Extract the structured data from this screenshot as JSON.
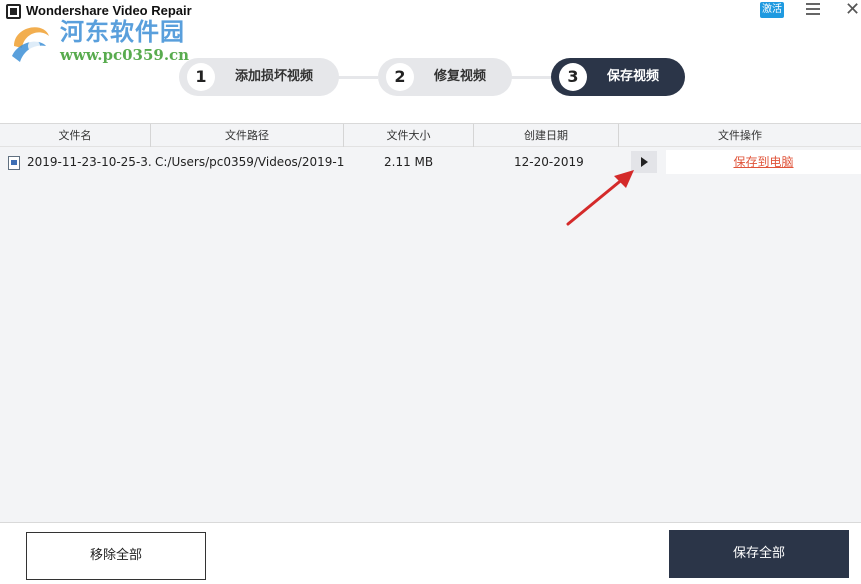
{
  "window": {
    "title": "Wondershare Video Repair",
    "activate_label": "激活",
    "menu_icon": "hamburger-menu-icon",
    "close_icon": "close-icon",
    "close_glyph": "✕"
  },
  "watermark": {
    "site_name": "河东软件园",
    "site_url": "www.pc0359.cn"
  },
  "steps": [
    {
      "number": "1",
      "label": "添加损坏视频",
      "active": false
    },
    {
      "number": "2",
      "label": "修复视频",
      "active": false
    },
    {
      "number": "3",
      "label": "保存视频",
      "active": true
    }
  ],
  "table": {
    "columns": [
      "文件名",
      "文件路径",
      "文件大小",
      "创建日期",
      "文件操作"
    ],
    "rows": [
      {
        "name": "2019-11-23-10-25-3...",
        "path": "C:/Users/pc0359/Videos/2019-1...",
        "size": "2.11  MB",
        "date": "12-20-2019",
        "action": "保存到电脑"
      }
    ]
  },
  "footer": {
    "remove_all_label": "移除全部",
    "save_all_label": "保存全部"
  },
  "colors": {
    "accent_dark": "#2b3548",
    "link": "#e0543a",
    "activate_bg": "#1f9ae0",
    "arrow": "#d42a2a"
  }
}
